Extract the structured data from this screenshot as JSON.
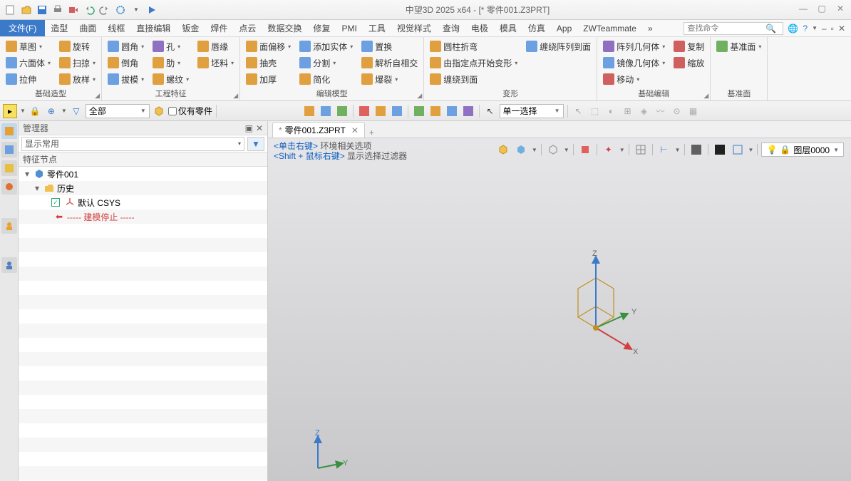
{
  "app": {
    "title": "中望3D 2025 x64 - [* 零件001.Z3PRT]",
    "window_buttons": {
      "min": "—",
      "max": "▢",
      "close": "✕"
    }
  },
  "qat": [
    "new",
    "open",
    "save",
    "print",
    "export",
    "undo",
    "redo",
    "settings",
    "dropdown",
    "play"
  ],
  "menus": {
    "file": "文件(F)",
    "items": [
      "造型",
      "曲面",
      "线框",
      "直接编辑",
      "钣金",
      "焊件",
      "点云",
      "数据交换",
      "修复",
      "PMI",
      "工具",
      "视觉样式",
      "查询",
      "电极",
      "模具",
      "仿真",
      "App",
      "ZWTeammate"
    ],
    "overflow": "»",
    "search_placeholder": "查找命令",
    "help_icons": [
      "globe",
      "help",
      "dropdown"
    ],
    "winctrl": [
      "–",
      "▢",
      "✕"
    ]
  },
  "ribbon": {
    "groups": [
      {
        "name": "基础造型",
        "launcher": true,
        "cols": [
          [
            {
              "ico": "or",
              "label": "草图",
              "dd": true
            },
            {
              "ico": "",
              "label": "六面体",
              "dd": true
            },
            {
              "ico": "",
              "label": "拉伸"
            }
          ],
          [
            {
              "ico": "or",
              "label": "旋转"
            },
            {
              "ico": "or",
              "label": "扫掠",
              "dd": true
            },
            {
              "ico": "or",
              "label": "放样",
              "dd": true
            }
          ]
        ]
      },
      {
        "name": "工程特征",
        "launcher": true,
        "cols": [
          [
            {
              "ico": "",
              "label": "圆角",
              "dd": true
            },
            {
              "ico": "or",
              "label": "倒角"
            },
            {
              "ico": "",
              "label": "拔模",
              "dd": true
            }
          ],
          [
            {
              "ico": "pu",
              "label": "孔",
              "dd": true
            },
            {
              "ico": "or",
              "label": "肋",
              "dd": true
            },
            {
              "ico": "or",
              "label": "螺纹",
              "dd": true
            }
          ],
          [
            {
              "ico": "or",
              "label": "唇缘"
            },
            {
              "ico": "or",
              "label": "坯料",
              "dd": true
            },
            {
              "ico": "",
              "label": ""
            }
          ]
        ]
      },
      {
        "name": "编辑模型",
        "launcher": true,
        "cols": [
          [
            {
              "ico": "or",
              "label": "面偏移",
              "dd": true
            },
            {
              "ico": "or",
              "label": "抽壳"
            },
            {
              "ico": "or",
              "label": "加厚"
            }
          ],
          [
            {
              "ico": "",
              "label": "添加实体",
              "dd": true
            },
            {
              "ico": "",
              "label": "分割",
              "dd": true
            },
            {
              "ico": "or",
              "label": "简化"
            }
          ],
          [
            {
              "ico": "",
              "label": "置换"
            },
            {
              "ico": "or",
              "label": "解析自相交"
            },
            {
              "ico": "or",
              "label": "爆裂",
              "dd": true
            }
          ]
        ]
      },
      {
        "name": "变形",
        "cols": [
          [
            {
              "ico": "or",
              "label": "圆柱折弯"
            },
            {
              "ico": "or",
              "label": "由指定点开始变形",
              "dd": true
            },
            {
              "ico": "or",
              "label": "缠绕到面"
            }
          ],
          [
            {
              "ico": "",
              "label": "缠绕阵列到面"
            },
            {
              "ico": "",
              "label": ""
            },
            {
              "ico": "",
              "label": ""
            }
          ]
        ]
      },
      {
        "name": "基础编辑",
        "launcher": true,
        "cols": [
          [
            {
              "ico": "pu",
              "label": "阵列几何体",
              "dd": true
            },
            {
              "ico": "",
              "label": "镜像几何体",
              "dd": true
            },
            {
              "ico": "rd",
              "label": "移动",
              "dd": true
            }
          ],
          [
            {
              "ico": "rd",
              "label": "复制"
            },
            {
              "ico": "rd",
              "label": "缩放"
            },
            {
              "ico": "",
              "label": ""
            }
          ]
        ]
      },
      {
        "name": "基准面",
        "cols": [
          [
            {
              "ico": "gr",
              "label": "基准面",
              "dd": true
            },
            {
              "ico": "",
              "label": ""
            },
            {
              "ico": "",
              "label": ""
            }
          ]
        ]
      }
    ]
  },
  "toolbar2": {
    "mode_label": "全部",
    "filter_label": "仅有零件",
    "select_mode": "单一选择"
  },
  "manager": {
    "title": "管理器",
    "dropdown": "显示常用",
    "header": "特征节点",
    "tree": {
      "root": "零件001",
      "history": "历史",
      "csys": "默认 CSYS",
      "stop": "----- 建模停止 -----"
    }
  },
  "viewport": {
    "tab_name": "零件001.Z3PRT",
    "hint1_prefix": "<单击右键>",
    "hint1_text": "环境相关选项",
    "hint2_prefix": "<Shift + 鼠标右键>",
    "hint2_text": "显示选择过滤器",
    "layer": "图层0000",
    "axes": {
      "x": "X",
      "y": "Y",
      "z": "Z"
    }
  }
}
